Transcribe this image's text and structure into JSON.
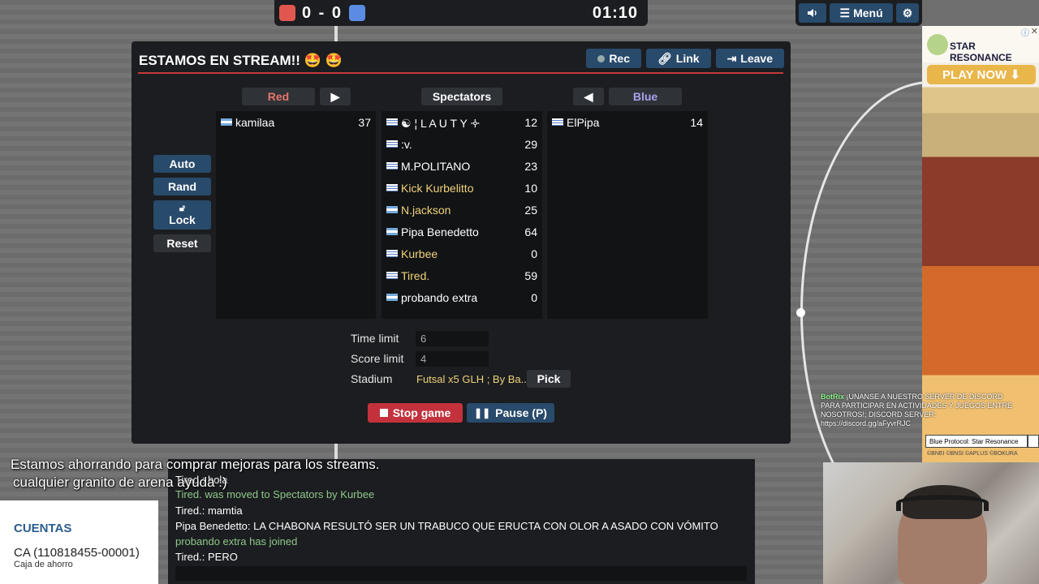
{
  "scorebar": {
    "score": "0 - 0",
    "clock": "01:10"
  },
  "topright": {
    "sound_icon": "speaker-icon",
    "menu_label": "Menú",
    "settings_icon": "gear-icon"
  },
  "dialog": {
    "title": "ESTAMOS EN STREAM!! 🤩 🤩",
    "rec_label": "Rec",
    "link_label": "Link",
    "leave_label": "Leave",
    "red_label": "Red",
    "spectators_label": "Spectators",
    "blue_label": "Blue",
    "red_players": [
      {
        "flag": "ar",
        "name": "kamilaa",
        "points": "37",
        "highlight": false
      }
    ],
    "spectators": [
      {
        "flag": "uy",
        "name": "☯︎ ¦ L A U T Y 🝊",
        "points": "12",
        "highlight": false
      },
      {
        "flag": "uy",
        "name": ":v.",
        "points": "29",
        "highlight": false
      },
      {
        "flag": "uy",
        "name": "M.POLITANO",
        "points": "23",
        "highlight": false
      },
      {
        "flag": "uy",
        "name": "Kick Kurbelitto",
        "points": "10",
        "highlight": true
      },
      {
        "flag": "ar",
        "name": "N.jackson",
        "points": "25",
        "highlight": true
      },
      {
        "flag": "ar",
        "name": "Pipa Benedetto",
        "points": "64",
        "highlight": false
      },
      {
        "flag": "uy",
        "name": "Kurbee",
        "points": "0",
        "highlight": true
      },
      {
        "flag": "uy",
        "name": "Tired.",
        "points": "59",
        "highlight": true
      },
      {
        "flag": "ar",
        "name": "probando extra",
        "points": "0",
        "highlight": false
      }
    ],
    "blue_players": [
      {
        "flag": "uy",
        "name": "ElPipa",
        "points": "14",
        "highlight": false
      }
    ],
    "side_buttons": {
      "auto": "Auto",
      "rand": "Rand",
      "lock": "Lock",
      "reset": "Reset"
    },
    "time_limit_label": "Time limit",
    "time_limit_value": "6",
    "score_limit_label": "Score limit",
    "score_limit_value": "4",
    "stadium_label": "Stadium",
    "stadium_value": "Futsal x5 GLH ; By Ba...",
    "pick_label": "Pick",
    "stop_label": "Stop game",
    "pause_label": "Pause (P)",
    "colors": {
      "red": "#c33a3a",
      "button_blue": "#284a6b",
      "team_red_text": "#e8756b",
      "team_blue_text": "#a9a3ec"
    }
  },
  "chat": {
    "lines": [
      {
        "text": "Tired.: hola",
        "green": false
      },
      {
        "text": "Tired. was moved to Spectators by Kurbee",
        "green": true
      },
      {
        "text": "Tired.: mamtia",
        "green": false
      },
      {
        "text": "Pipa Benedetto: LA CHABONA RESULTÓ SER UN TRABUCO QUE ERUCTA CON OLOR A ASADO CON VÓMITO",
        "green": false
      },
      {
        "text": "probando extra has joined",
        "green": true
      },
      {
        "text": "Tired.: PERO",
        "green": false
      }
    ]
  },
  "overlay": {
    "line1": "Estamos ahorrando para comprar mejoras para los streams.",
    "line2": "cualquier granito de arena ayuda :)"
  },
  "cuentas": {
    "title": "CUENTAS",
    "account": "CA (110818455-00001)",
    "type": "Caja de ahorro"
  },
  "ad": {
    "logo": "STAR RESONANCE",
    "play": "PLAY NOW ⬇",
    "caption": "Blue Protocol: Star Resonance",
    "copy": "©BNEI ©BNSI ©APLUS ©BOKURA"
  },
  "botrix": {
    "name": "BotRix",
    "message": "¡UNANSE A NUESTRO SERVER DE DISCORD PARA PARTICIPAR EN ACTIVIDADES Y JUEGOS ENTRE NOSOTROS!; DISCORD SERVER: https://discord.gg/aFyvrRJC"
  }
}
